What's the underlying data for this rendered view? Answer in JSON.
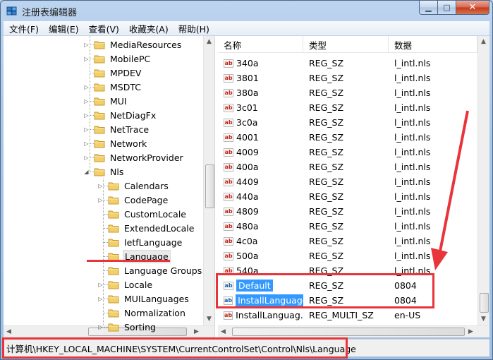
{
  "window": {
    "title": "注册表编辑器",
    "controls": {
      "minimize": "▁",
      "maximize": "□",
      "close": "✕"
    }
  },
  "menu": [
    "文件(F)",
    "编辑(E)",
    "查看(V)",
    "收藏夹(A)",
    "帮助(H)"
  ],
  "tree": {
    "items": [
      {
        "label": "MediaResources",
        "level": 1,
        "expander": "collapsed"
      },
      {
        "label": "MobilePC",
        "level": 1,
        "expander": "collapsed"
      },
      {
        "label": "MPDEV",
        "level": 1,
        "expander": "none"
      },
      {
        "label": "MSDTC",
        "level": 1,
        "expander": "collapsed"
      },
      {
        "label": "MUI",
        "level": 1,
        "expander": "collapsed"
      },
      {
        "label": "NetDiagFx",
        "level": 1,
        "expander": "collapsed"
      },
      {
        "label": "NetTrace",
        "level": 1,
        "expander": "collapsed"
      },
      {
        "label": "Network",
        "level": 1,
        "expander": "collapsed"
      },
      {
        "label": "NetworkProvider",
        "level": 1,
        "expander": "collapsed"
      },
      {
        "label": "Nls",
        "level": 1,
        "expander": "expanded"
      },
      {
        "label": "Calendars",
        "level": 2,
        "expander": "collapsed"
      },
      {
        "label": "CodePage",
        "level": 2,
        "expander": "collapsed"
      },
      {
        "label": "CustomLocale",
        "level": 2,
        "expander": "none"
      },
      {
        "label": "ExtendedLocale",
        "level": 2,
        "expander": "none"
      },
      {
        "label": "IetfLanguage",
        "level": 2,
        "expander": "none"
      },
      {
        "label": "Language",
        "level": 2,
        "expander": "none",
        "selected": true
      },
      {
        "label": "Language Groups",
        "level": 2,
        "expander": "none"
      },
      {
        "label": "Locale",
        "level": 2,
        "expander": "collapsed"
      },
      {
        "label": "MUILanguages",
        "level": 2,
        "expander": "collapsed"
      },
      {
        "label": "Normalization",
        "level": 2,
        "expander": "none"
      },
      {
        "label": "Sorting",
        "level": 2,
        "expander": "collapsed"
      }
    ]
  },
  "list": {
    "columns": [
      "名称",
      "类型",
      "数据"
    ],
    "rows": [
      {
        "name": "340a",
        "type": "REG_SZ",
        "data": "l_intl.nls",
        "icon": "ab"
      },
      {
        "name": "3801",
        "type": "REG_SZ",
        "data": "l_intl.nls",
        "icon": "ab"
      },
      {
        "name": "380a",
        "type": "REG_SZ",
        "data": "l_intl.nls",
        "icon": "ab"
      },
      {
        "name": "3c01",
        "type": "REG_SZ",
        "data": "l_intl.nls",
        "icon": "ab"
      },
      {
        "name": "3c0a",
        "type": "REG_SZ",
        "data": "l_intl.nls",
        "icon": "ab"
      },
      {
        "name": "4001",
        "type": "REG_SZ",
        "data": "l_intl.nls",
        "icon": "ab"
      },
      {
        "name": "4009",
        "type": "REG_SZ",
        "data": "l_intl.nls",
        "icon": "ab"
      },
      {
        "name": "400a",
        "type": "REG_SZ",
        "data": "l_intl.nls",
        "icon": "ab"
      },
      {
        "name": "4409",
        "type": "REG_SZ",
        "data": "l_intl.nls",
        "icon": "ab"
      },
      {
        "name": "440a",
        "type": "REG_SZ",
        "data": "l_intl.nls",
        "icon": "ab"
      },
      {
        "name": "4809",
        "type": "REG_SZ",
        "data": "l_intl.nls",
        "icon": "ab"
      },
      {
        "name": "480a",
        "type": "REG_SZ",
        "data": "l_intl.nls",
        "icon": "ab"
      },
      {
        "name": "4c0a",
        "type": "REG_SZ",
        "data": "l_intl.nls",
        "icon": "ab"
      },
      {
        "name": "500a",
        "type": "REG_SZ",
        "data": "l_intl.nls",
        "icon": "ab"
      },
      {
        "name": "540a",
        "type": "REG_SZ",
        "data": "l_intl.nls",
        "icon": "ab"
      },
      {
        "name": "Default",
        "type": "REG_SZ",
        "data": "0804",
        "icon": "ab",
        "selected": true
      },
      {
        "name": "InstallLanguage",
        "type": "REG_SZ",
        "data": "0804",
        "icon": "ab",
        "selected": true
      },
      {
        "name": "InstallLanguag...",
        "type": "REG_MULTI_SZ",
        "data": "en-US",
        "icon": "ab"
      }
    ]
  },
  "statusbar": {
    "path": "计算机\\HKEY_LOCAL_MACHINE\\SYSTEM\\CurrentControlSet\\Control\\Nls\\Language"
  },
  "colors": {
    "annotation": "#e8343b",
    "selection": "#3399ff",
    "folder": "#e8c15a"
  },
  "icons": {
    "app": "registry-editor-icon",
    "folder": "folder-icon",
    "value": "string-value-icon"
  }
}
